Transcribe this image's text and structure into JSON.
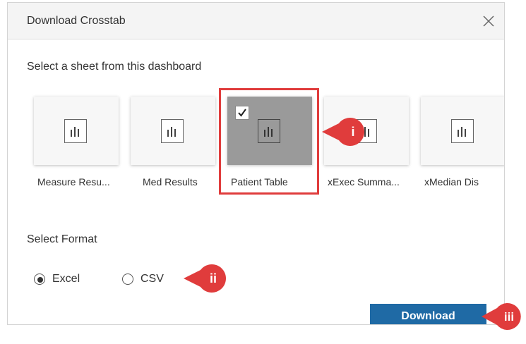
{
  "dialog": {
    "title": "Download Crosstab",
    "prompt": "Select a sheet from this dashboard",
    "sheets": [
      {
        "label": "Measure Resu...",
        "selected": false
      },
      {
        "label": "Med Results",
        "selected": false
      },
      {
        "label": "Patient Table",
        "selected": true
      },
      {
        "label": "xExec Summa...",
        "selected": false
      },
      {
        "label": "xMedian Dis",
        "selected": false
      }
    ],
    "format_title": "Select Format",
    "formats": [
      {
        "label": "Excel",
        "selected": true
      },
      {
        "label": "CSV",
        "selected": false
      }
    ],
    "download_label": "Download"
  },
  "callouts": {
    "i": "i",
    "ii": "ii",
    "iii": "iii"
  },
  "colors": {
    "accent": "#1f6aa5",
    "callout": "#e03c3c",
    "selected_card": "#9a9a9a"
  }
}
